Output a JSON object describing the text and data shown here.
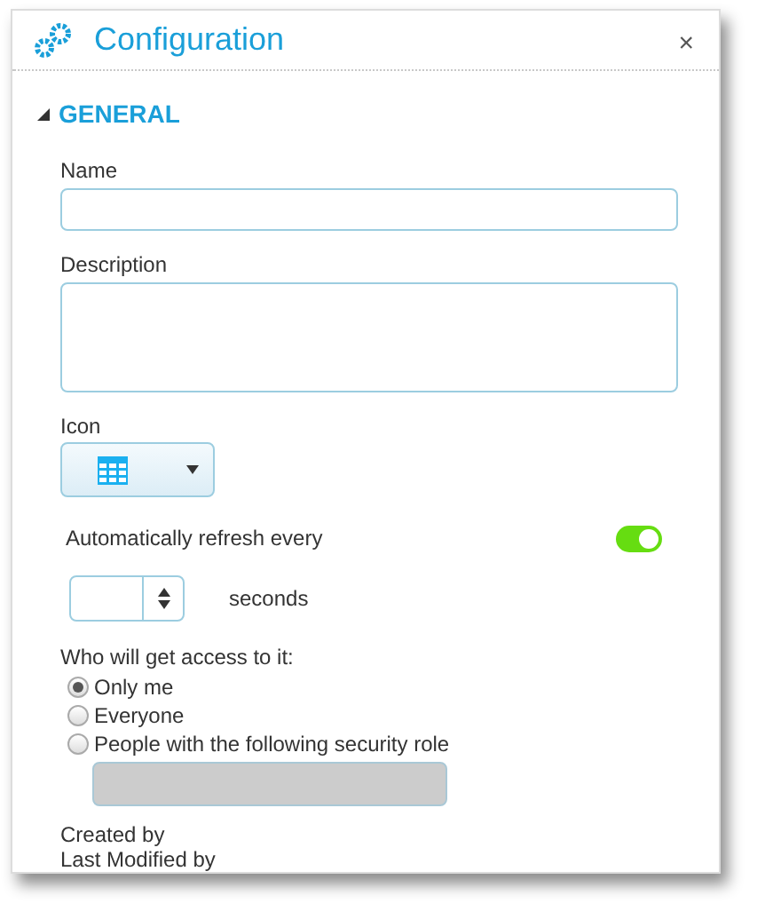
{
  "window": {
    "title": "Configuration",
    "close": "×"
  },
  "section": {
    "title": "GENERAL",
    "expanded": true
  },
  "fields": {
    "name_label": "Name",
    "description_label": "Description",
    "icon_label": "Icon"
  },
  "refresh": {
    "label": "Automatically refresh every",
    "on": true,
    "unit": "seconds"
  },
  "access": {
    "label": "Who will get access to it:",
    "options": [
      {
        "label": "Only me",
        "selected": true
      },
      {
        "label": "Everyone",
        "selected": false
      },
      {
        "label": "People with the following security role",
        "selected": false
      }
    ],
    "role_field": {
      "disabled": true
    }
  },
  "meta": [
    "Created by",
    "Last Modified by"
  ]
}
